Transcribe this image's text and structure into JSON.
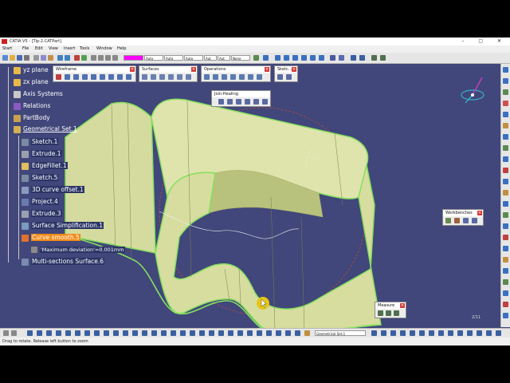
{
  "app": {
    "title": "CATIA V5 - [Tip-2.CATPart]",
    "window_controls": "– ▢ ✕"
  },
  "menu": {
    "items": [
      "Start",
      "File",
      "Edit",
      "View",
      "Insert",
      "Tools",
      "Window",
      "Help"
    ]
  },
  "toolbar": {
    "color_value": "",
    "line_type": "Auto",
    "thickness": "Auto",
    "weight": "Auto",
    "layer": "Aut",
    "layer_filter": "Aut",
    "render_style": "None"
  },
  "panels": {
    "wireframe": "Wireframe",
    "surfaces": "Surfaces",
    "operations": "Operations",
    "sketcher": "Sketc...",
    "join_healing": "Join-Healing",
    "workbenches": "Workbenches",
    "measure": "Measure"
  },
  "tree": {
    "items": [
      {
        "label": "yz plane"
      },
      {
        "label": "zx plane"
      },
      {
        "label": "Axis Systems"
      },
      {
        "label": "Relations"
      },
      {
        "label": "PartBody"
      },
      {
        "label": "Geometrical Set.1"
      },
      {
        "label": "Sketch.1"
      },
      {
        "label": "Extrude.1"
      },
      {
        "label": "EdgeFillet.1"
      },
      {
        "label": "Sketch.5"
      },
      {
        "label": "3D curve offset.1"
      },
      {
        "label": "Project.4"
      },
      {
        "label": "Extrude.3"
      },
      {
        "label": "Surface Simplification.1"
      },
      {
        "label": "Curve smooth.5"
      },
      {
        "label": "'Maximum deviation'=0.001mm"
      },
      {
        "label": "Multi-sections Surface.6"
      }
    ]
  },
  "bottom_toolbar": {
    "geometrical_set_selector": "Geometrical Set.1"
  },
  "status_bar": {
    "message": "Drag to rotate. Release left button to zoom",
    "indicator": "2/11"
  },
  "colors": {
    "background": "#41477a",
    "surface_fill": "#d9dfa7",
    "surface_shade": "#c5ce8c",
    "edge_highlight": "#7fe060",
    "active_node": "#f08c1a",
    "cursor": "#e7c516"
  }
}
